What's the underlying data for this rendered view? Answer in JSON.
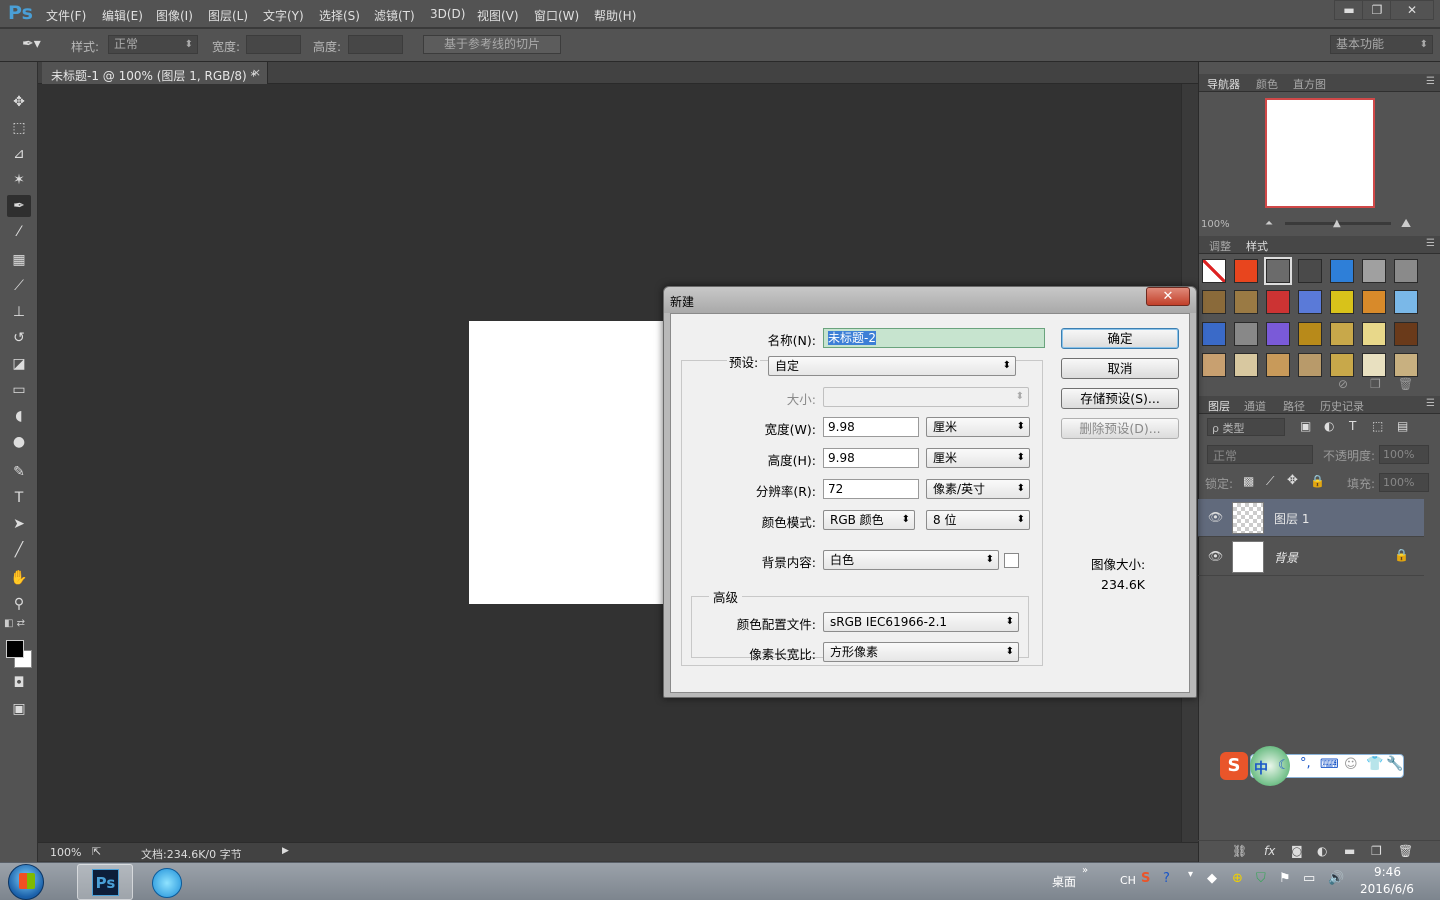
{
  "app": {
    "logo": "Ps"
  },
  "menubar": {
    "items": [
      "文件(F)",
      "编辑(E)",
      "图像(I)",
      "图层(L)",
      "文字(Y)",
      "选择(S)",
      "滤镜(T)",
      "3D(D)",
      "视图(V)",
      "窗口(W)",
      "帮助(H)"
    ],
    "window_buttons": {
      "minimize": "▬",
      "restore": "❐",
      "close": "✕"
    }
  },
  "options_bar": {
    "style_label": "样式:",
    "style_value": "正常",
    "width_label": "宽度:",
    "height_label": "高度:",
    "slice_button": "基于参考线的切片",
    "workspace": "基本功能"
  },
  "document": {
    "tab_title": "未标题-1 @ 100% (图层 1, RGB/8) *",
    "tab_close": "×"
  },
  "status_bar": {
    "zoom": "100%",
    "doc_info": "文档:234.6K/0 字节"
  },
  "navigator": {
    "tabs": [
      "导航器",
      "颜色",
      "直方图"
    ],
    "zoom": "100%"
  },
  "styles_panel": {
    "tabs": [
      "调整",
      "样式"
    ]
  },
  "layers_panel": {
    "tabs": [
      "图层",
      "通道",
      "路径",
      "历史记录"
    ],
    "filter_label": "ρ 类型",
    "blend_mode": "正常",
    "opacity_label": "不透明度:",
    "opacity_value": "100%",
    "lock_label": "锁定:",
    "fill_label": "填充:",
    "fill_value": "100%",
    "layers": [
      {
        "name": "图层 1",
        "selected": true
      },
      {
        "name": "背景",
        "locked": true
      }
    ]
  },
  "dialog": {
    "title": "新建",
    "close": "✕",
    "name_label": "名称(N):",
    "name_value": "未标题-2",
    "preset_label": "预设:",
    "preset_value": "自定",
    "size_label": "大小:",
    "size_value": "",
    "width_label": "宽度(W):",
    "width_value": "9.98",
    "width_unit": "厘米",
    "height_label": "高度(H):",
    "height_value": "9.98",
    "height_unit": "厘米",
    "resolution_label": "分辨率(R):",
    "resolution_value": "72",
    "resolution_unit": "像素/英寸",
    "color_mode_label": "颜色模式:",
    "color_mode_value": "RGB 颜色",
    "bit_depth": "8 位",
    "bg_label": "背景内容:",
    "bg_value": "白色",
    "advanced_label": "高级",
    "profile_label": "颜色配置文件:",
    "profile_value": "sRGB IEC61966-2.1",
    "aspect_label": "像素长宽比:",
    "aspect_value": "方形像素",
    "ok": "确定",
    "cancel": "取消",
    "save_preset": "存储预设(S)...",
    "delete_preset": "删除预设(D)...",
    "image_size_label": "图像大小:",
    "image_size_value": "234.6K"
  },
  "ime": {
    "mode": "中"
  },
  "taskbar": {
    "desktop": "桌面",
    "lang": "CH",
    "time": "9:46",
    "date": "2016/6/6"
  }
}
